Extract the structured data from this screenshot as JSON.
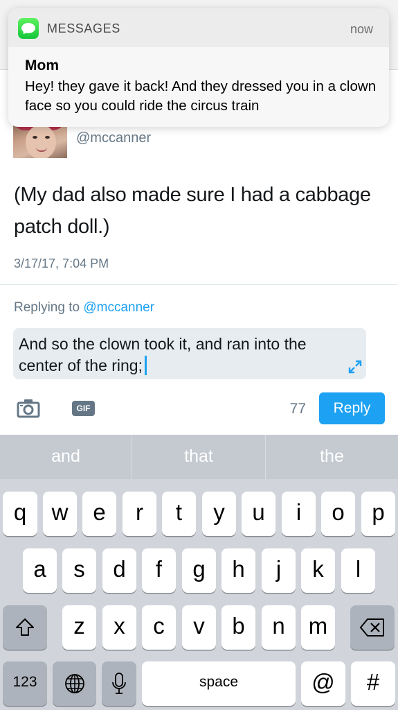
{
  "notification": {
    "app_name": "MESSAGES",
    "time": "now",
    "sender": "Mom",
    "body": "Hey! they gave it back! And they dressed you in a clown face so you could ride the circus train"
  },
  "tweet": {
    "handle": "@mccanner",
    "text": "(My dad also made sure I had a cabbage patch doll.)",
    "timestamp": "3/17/17, 7:04 PM"
  },
  "reply": {
    "replying_prefix": "Replying to",
    "replying_to": "@mccanner",
    "draft": "And so the clown took it, and ran into the center of the ring;",
    "gif_label": "GIF",
    "char_remaining": "77",
    "button_label": "Reply"
  },
  "keyboard": {
    "predictions": [
      "and",
      "that",
      "the"
    ],
    "row1": [
      "q",
      "w",
      "e",
      "r",
      "t",
      "y",
      "u",
      "i",
      "o",
      "p"
    ],
    "row2": [
      "a",
      "s",
      "d",
      "f",
      "g",
      "h",
      "j",
      "k",
      "l"
    ],
    "row3": [
      "z",
      "x",
      "c",
      "v",
      "b",
      "n",
      "m"
    ],
    "numbers_label": "123",
    "space_label": "space",
    "at_label": "@",
    "hash_label": "#"
  },
  "colors": {
    "accent": "#1da1f2",
    "muted": "#657786",
    "keyboard_bg": "#d1d5db"
  }
}
